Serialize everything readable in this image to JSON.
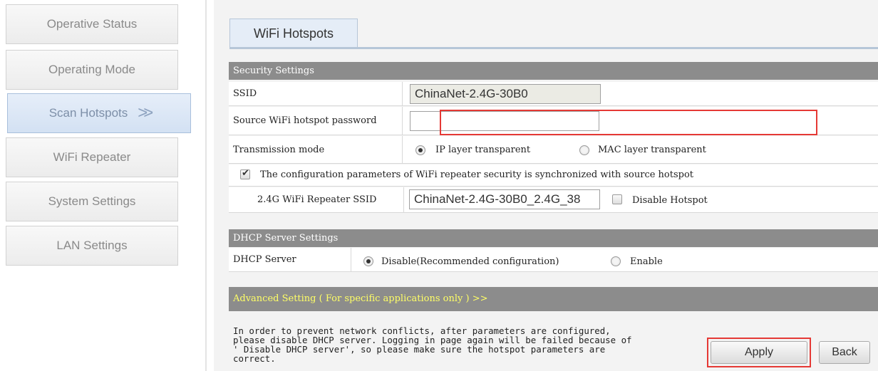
{
  "sidebar": {
    "items": [
      {
        "label": "Operative Status"
      },
      {
        "label": "Operating Mode"
      },
      {
        "label": "Scan Hotspots",
        "arrow": ">>"
      },
      {
        "label": "WiFi Repeater"
      },
      {
        "label": "System Settings"
      },
      {
        "label": "LAN Settings"
      }
    ]
  },
  "main": {
    "tab_label": "WiFi Hotspots",
    "security": {
      "header": "Security Settings",
      "ssid_label": "SSID",
      "ssid_value": "ChinaNet-2.4G-30B0",
      "password_label": "Source WiFi hotspot password",
      "password_value": "",
      "transmission_label": "Transmission mode",
      "transmission_options": [
        "IP layer transparent",
        "MAC layer transparent"
      ],
      "transmission_selected": "IP layer transparent",
      "sync_label": "The configuration parameters of WiFi repeater security is synchronized with source hotspot",
      "sync_checked": true,
      "repeater_ssid_label": "2.4G WiFi Repeater SSID",
      "repeater_ssid_value": "ChinaNet-2.4G-30B0_2.4G_38",
      "disable_hotspot_label": "Disable Hotspot",
      "disable_hotspot_checked": false
    },
    "dhcp": {
      "header": "DHCP Server Settings",
      "label": "DHCP Server",
      "options": [
        "Disable(Recommended configuration)",
        "Enable"
      ],
      "selected": "Disable(Recommended configuration)"
    },
    "advanced_label": "Advanced Setting ( For specific applications only ) >>",
    "notice": "In order to prevent network conflicts, after parameters are configured,\nplease disable DHCP server. Logging in page again will be failed because of\n' Disable DHCP server', so please make sure the hotspot parameters are\ncorrect.",
    "buttons": {
      "apply": "Apply",
      "back": "Back"
    }
  },
  "colors": {
    "section_header_bg": "#8c8c8c",
    "advanced_text": "#ffff66",
    "highlight": "#e53935",
    "active_nav_bg": "#dbe6f5"
  }
}
